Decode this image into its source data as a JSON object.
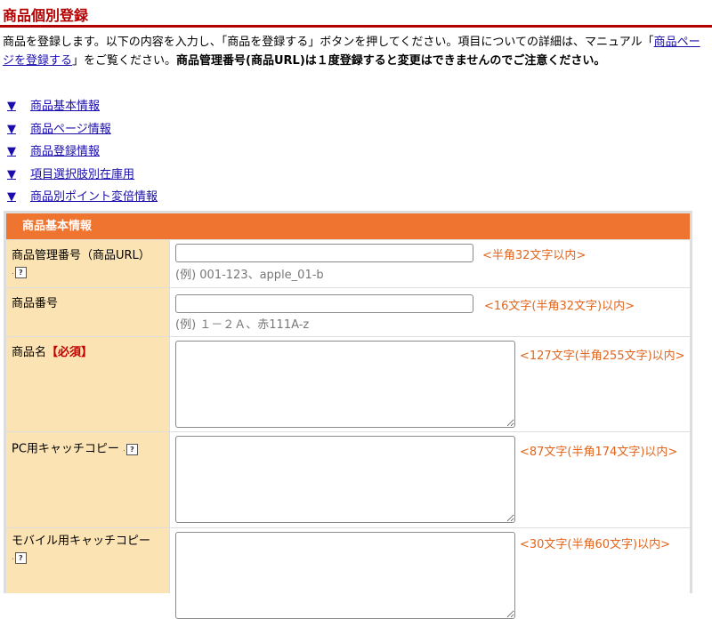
{
  "header": {
    "title": "商品個別登録"
  },
  "intro": {
    "text_before_link": "商品を登録します。以下の内容を入力し、「商品を登録する」ボタンを押してください。項目についての詳細は、マニュアル「",
    "manual_link": "商品ページを登録する",
    "text_after_link": "」をご覧ください。",
    "warning": "商品管理番号(商品URL)は１度登録すると変更はできませんのでご注意ください。"
  },
  "toc": {
    "marker": "▼",
    "items": [
      {
        "label": "商品基本情報"
      },
      {
        "label": "商品ページ情報"
      },
      {
        "label": "商品登録情報"
      },
      {
        "label": "項目選択肢別在庫用"
      },
      {
        "label": "商品別ポイント変倍情報"
      }
    ]
  },
  "section": {
    "title": "商品基本情報",
    "help_glyph": "?",
    "fields": [
      {
        "label": "商品管理番号（商品URL）",
        "value": "",
        "example": "(例) 001-123、apple_01-b",
        "limit": "<半角32文字以内>"
      },
      {
        "label": "商品番号",
        "value": "",
        "example": "(例) １－２Ａ、赤111A-z",
        "limit": "<16文字(半角32文字)以内>"
      },
      {
        "label": "商品名",
        "required": "【必須】",
        "value": "",
        "limit": "<127文字(半角255文字)以内>"
      },
      {
        "label": "PC用キャッチコピー",
        "value": "",
        "limit": "<87文字(半角174文字)以内>"
      },
      {
        "label": "モバイル用キャッチコピー",
        "value": "",
        "limit": "<30文字(半角60文字)以内>"
      }
    ]
  },
  "colors": {
    "title_red": "#b30000",
    "section_orange": "#ee7430",
    "label_bg": "#fce3b4",
    "limit_orange": "#e0651e",
    "link_blue": "#1a0dab"
  }
}
